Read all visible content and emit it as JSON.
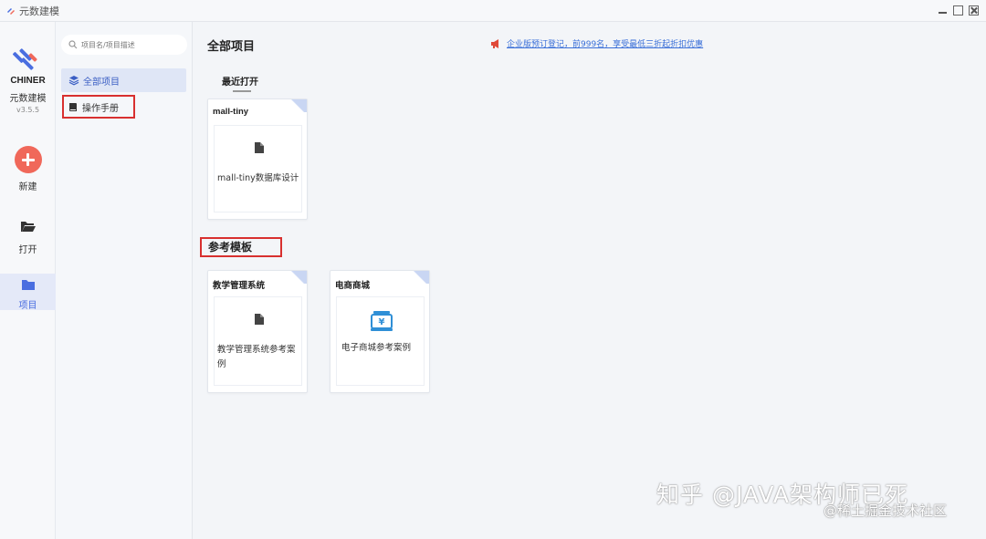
{
  "window": {
    "title": "元数建模"
  },
  "rail": {
    "brand_name": "CHINER",
    "brand_cn": "元数建模",
    "version": "v3.5.5",
    "new_label": "新建",
    "open_label": "打开",
    "project_label": "项目"
  },
  "sidebar": {
    "search_placeholder": "项目名/项目描述",
    "items": [
      {
        "label": "全部项目",
        "icon": "layers-icon",
        "selected": true
      },
      {
        "label": "操作手册",
        "icon": "book-icon",
        "selected": false
      }
    ]
  },
  "main": {
    "title": "全部项目",
    "notice": "企业版预订登记，前999名，享受最低三折起折扣优惠",
    "recent_label": "最近打开",
    "templates_label": "参考模板",
    "recent_cards": [
      {
        "name": "mall-tiny",
        "desc": "mall-tiny数据库设计",
        "icon": "file-icon"
      }
    ],
    "template_cards": [
      {
        "name": "教学管理系统",
        "desc": "教学管理系统参考案例",
        "icon": "file-icon"
      },
      {
        "name": "电商商城",
        "desc": "电子商城参考案例",
        "icon": "cash-register-icon"
      }
    ]
  },
  "watermark": {
    "line1": "知乎 @JAVA架构师已死",
    "line2": "@稀土掘金技术社区"
  },
  "colors": {
    "accent": "#4a6ee0",
    "new_button": "#f0685a",
    "highlight_box": "#d8302f",
    "notice_link": "#3a6fd8"
  }
}
